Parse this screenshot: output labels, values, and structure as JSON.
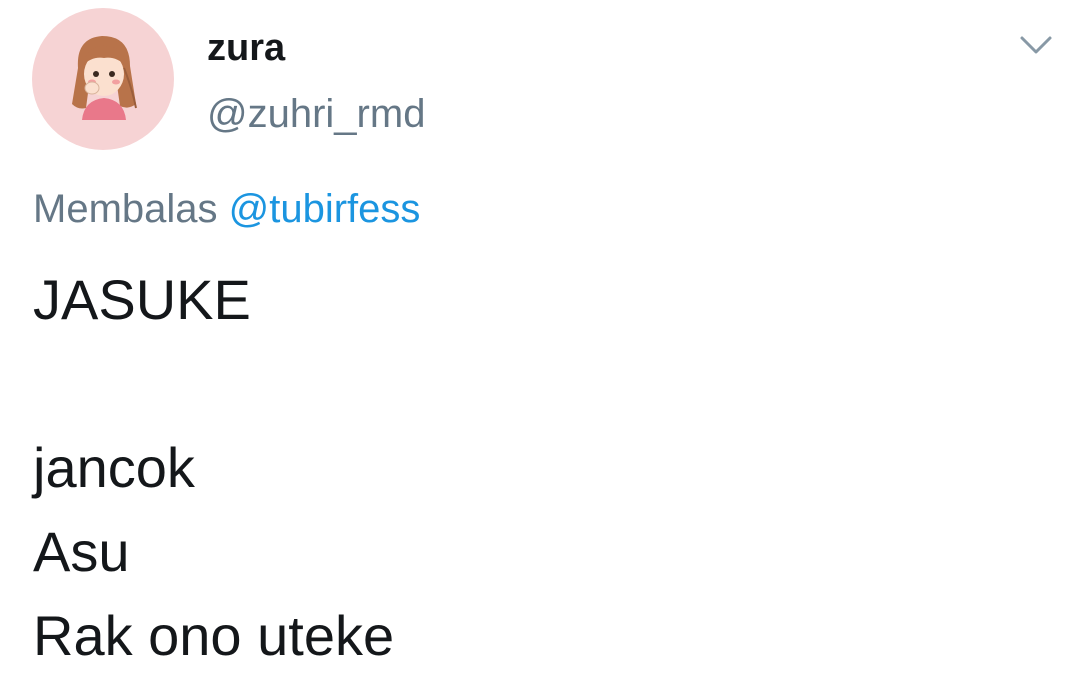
{
  "author": {
    "display_name": "zura",
    "handle": "@zuhri_rmd",
    "avatar_icon": "cartoon-girl-avatar-icon",
    "avatar_bg": "#f6d3d4"
  },
  "menu": {
    "icon": "chevron-down-icon"
  },
  "reply": {
    "prefix": "Membalas",
    "mention": "@tubirfess"
  },
  "tweet": {
    "lines": [
      "JASUKE",
      "",
      "jancok",
      "Asu",
      "Rak ono uteke"
    ]
  },
  "colors": {
    "text": "#14171a",
    "secondary": "#657786",
    "link": "#1b95e0"
  }
}
